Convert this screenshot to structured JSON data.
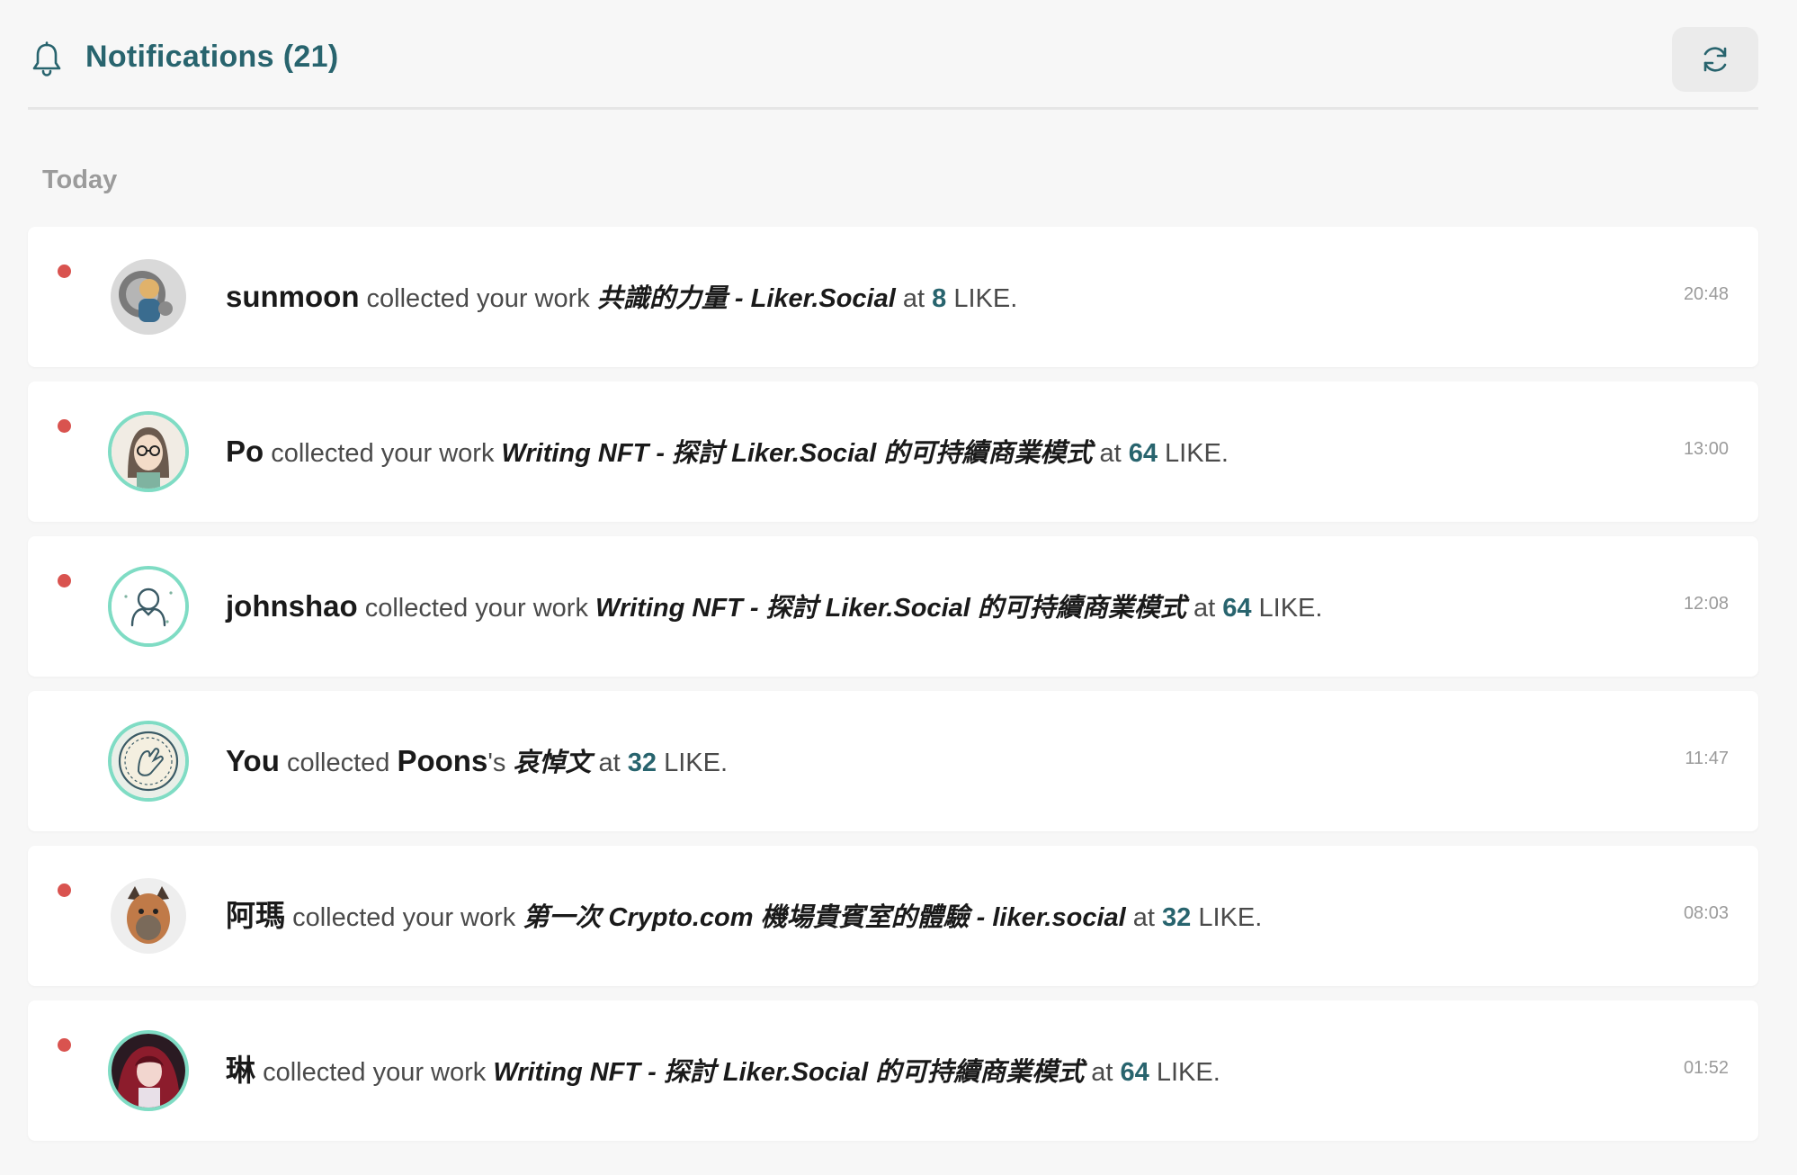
{
  "header": {
    "title": "Notifications",
    "count": "(21)",
    "bell_icon": "bell-icon",
    "refresh_icon": "refresh-icon"
  },
  "section": {
    "label": "Today"
  },
  "colors": {
    "accent": "#28646e",
    "unread_dot": "#d9534f",
    "avatar_ring": "#7fdcc4"
  },
  "notifications": [
    {
      "unread": true,
      "user": "sunmoon",
      "action": "collected your work",
      "work": "共識的力量 - Liker.Social",
      "at": "at",
      "amount": "8",
      "unit": "LIKE.",
      "time": "20:48"
    },
    {
      "unread": true,
      "user": "Po",
      "action": "collected your work",
      "work": "Writing NFT - 探討 Liker.Social 的可持續商業模式",
      "at": "at",
      "amount": "64",
      "unit": "LIKE.",
      "time": "13:00"
    },
    {
      "unread": true,
      "user": "johnshao",
      "action": "collected your work",
      "work": "Writing NFT - 探討 Liker.Social 的可持續商業模式",
      "at": "at",
      "amount": "64",
      "unit": "LIKE.",
      "time": "12:08"
    },
    {
      "unread": false,
      "user": "You",
      "action": "collected",
      "target_user": "Poons",
      "possessive": "'s",
      "work": "哀悼文",
      "at": "at",
      "amount": "32",
      "unit": "LIKE.",
      "time": "11:47"
    },
    {
      "unread": true,
      "user": "阿瑪",
      "action": "collected your work",
      "work": "第一次 Crypto.com 機場貴賓室的體驗 - liker.social",
      "at": "at",
      "amount": "32",
      "unit": "LIKE.",
      "time": "08:03"
    },
    {
      "unread": true,
      "user": "琳",
      "action": "collected your work",
      "work": "Writing NFT - 探討 Liker.Social 的可持續商業模式",
      "at": "at",
      "amount": "64",
      "unit": "LIKE.",
      "time": "01:52"
    }
  ]
}
